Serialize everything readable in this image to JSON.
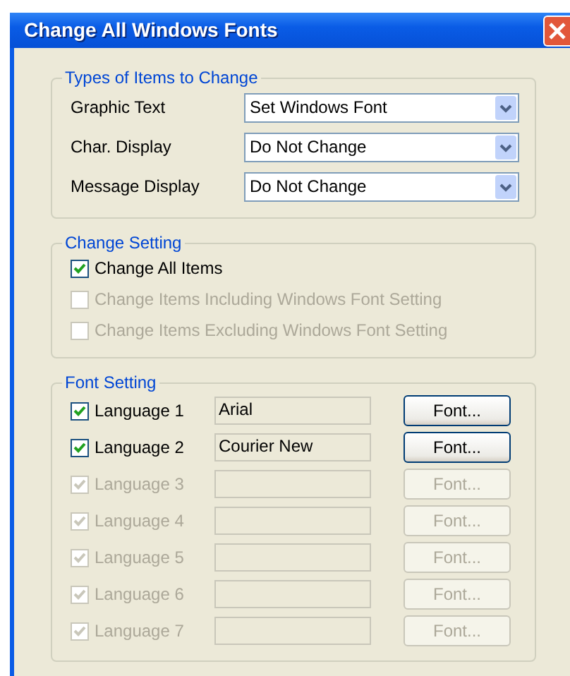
{
  "window": {
    "title": "Change All Windows Fonts"
  },
  "types_group": {
    "title": "Types of Items to Change",
    "rows": [
      {
        "label": "Graphic Text",
        "value": "Set Windows Font"
      },
      {
        "label": "Char. Display",
        "value": "Do Not Change"
      },
      {
        "label": "Message Display",
        "value": "Do Not Change"
      }
    ]
  },
  "change_setting": {
    "title": "Change Setting",
    "options": [
      {
        "label": "Change All Items",
        "checked": true,
        "disabled": false
      },
      {
        "label": "Change Items Including Windows Font Setting",
        "checked": false,
        "disabled": true
      },
      {
        "label": "Change Items Excluding Windows Font Setting",
        "checked": false,
        "disabled": true
      }
    ]
  },
  "font_setting": {
    "title": "Font Setting",
    "languages": [
      {
        "label": "Language 1",
        "checked": true,
        "disabled": false,
        "font": "Arial",
        "button": "Font..."
      },
      {
        "label": "Language 2",
        "checked": true,
        "disabled": false,
        "font": "Courier New",
        "button": "Font..."
      },
      {
        "label": "Language 3",
        "checked": true,
        "disabled": true,
        "button": "Font..."
      },
      {
        "label": "Language 4",
        "checked": true,
        "disabled": true,
        "button": "Font..."
      },
      {
        "label": "Language 5",
        "checked": true,
        "disabled": true,
        "button": "Font..."
      },
      {
        "label": "Language 6",
        "checked": true,
        "disabled": true,
        "button": "Font..."
      },
      {
        "label": "Language 7",
        "checked": true,
        "disabled": true,
        "button": "Font..."
      }
    ]
  }
}
